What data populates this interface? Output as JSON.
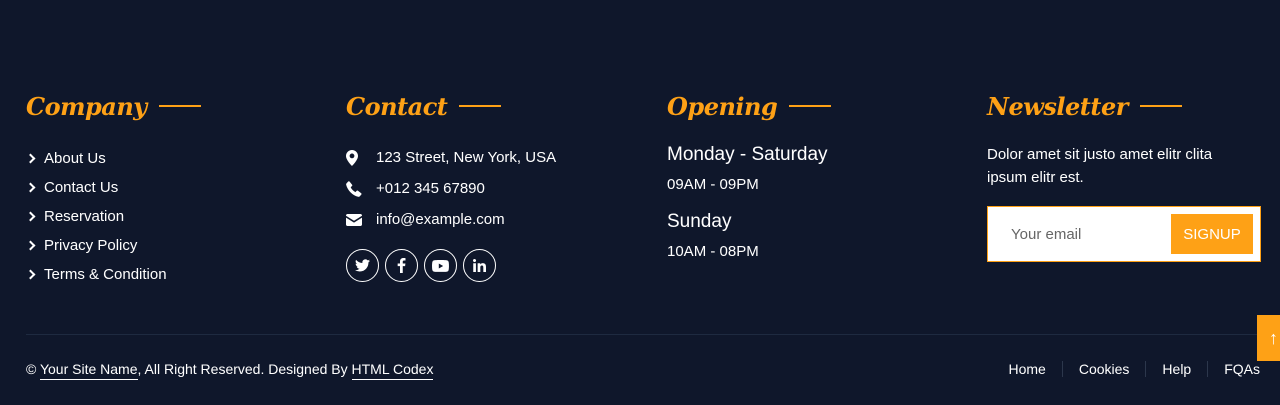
{
  "company": {
    "title": "Company",
    "links": [
      "About Us",
      "Contact Us",
      "Reservation",
      "Privacy Policy",
      "Terms & Condition"
    ]
  },
  "contact": {
    "title": "Contact",
    "address": "123 Street, New York, USA",
    "phone": "+012 345 67890",
    "email": "info@example.com",
    "socials": [
      "twitter-icon",
      "facebook-icon",
      "youtube-icon",
      "linkedin-icon"
    ]
  },
  "opening": {
    "title": "Opening",
    "day1": "Monday - Saturday",
    "hours1": "09AM - 09PM",
    "day2": "Sunday",
    "hours2": "10AM - 08PM"
  },
  "newsletter": {
    "title": "Newsletter",
    "text": "Dolor amet sit justo amet elitr clita ipsum elitr est.",
    "placeholder": "Your email",
    "button": "SIGNUP"
  },
  "bottom": {
    "copyright_prefix": "©",
    "site_name": "Your Site Name",
    "reserved": ", All Right Reserved. Designed By",
    "designer": "HTML Codex",
    "menu": [
      "Home",
      "Cookies",
      "Help",
      "FQAs"
    ]
  },
  "colors": {
    "background": "#0f172b",
    "accent": "#fea116"
  }
}
